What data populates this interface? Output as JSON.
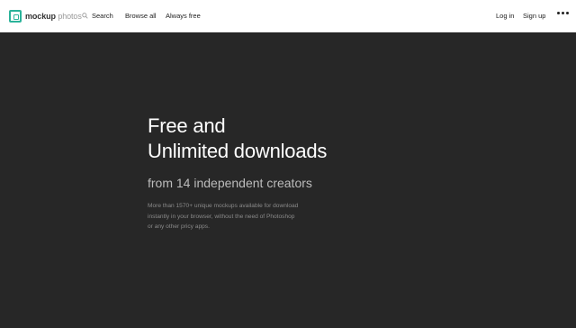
{
  "brand": {
    "name_bold": "mockup",
    "name_light": "photos"
  },
  "nav": {
    "search": "Search",
    "browse_all": "Browse all",
    "always_free": "Always free",
    "log_in": "Log in",
    "sign_up": "Sign up"
  },
  "hero": {
    "title_line1": "Free and",
    "title_line2": "Unlimited downloads",
    "subtitle": "from 14 independent creators",
    "desc_line1": "More than 1570+ unique mockups available for download",
    "desc_line2": "instantly in your browser, without the need of Photoshop",
    "desc_line3": "or any other pricy apps."
  },
  "colors": {
    "background": "#272727",
    "brand_accent": "#2bb39a",
    "topbar": "#ffffff"
  },
  "icons": [
    "logo-icon",
    "search-icon",
    "more-icon"
  ]
}
